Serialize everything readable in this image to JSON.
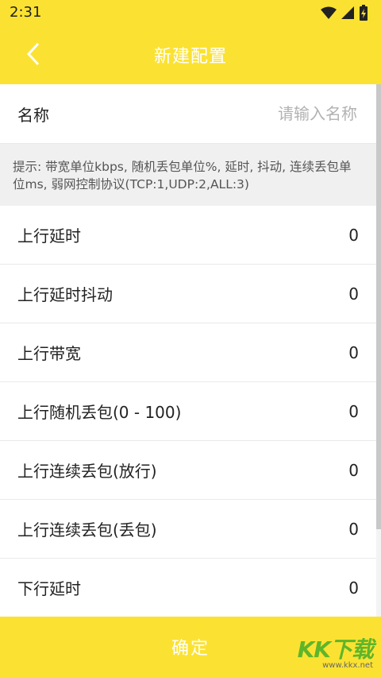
{
  "status": {
    "time": "2:31"
  },
  "header": {
    "title": "新建配置"
  },
  "name_field": {
    "label": "名称",
    "placeholder": "请输入名称",
    "value": ""
  },
  "hint": "提示: 带宽单位kbps, 随机丢包单位%, 延时, 抖动, 连续丢包单位ms, 弱网控制协议(TCP:1,UDP:2,ALL:3)",
  "rows": [
    {
      "label": "上行延时",
      "value": "0"
    },
    {
      "label": "上行延时抖动",
      "value": "0"
    },
    {
      "label": "上行带宽",
      "value": "0"
    },
    {
      "label": "上行随机丢包(0 - 100)",
      "value": "0"
    },
    {
      "label": "上行连续丢包(放行)",
      "value": "0"
    },
    {
      "label": "上行连续丢包(丢包)",
      "value": "0"
    },
    {
      "label": "下行延时",
      "value": "0"
    }
  ],
  "footer": {
    "confirm_label": "确定"
  },
  "watermark": {
    "logo": "KK下载",
    "url": "www.kkx.net"
  },
  "colors": {
    "accent": "#fbe232",
    "hint_bg": "#f0f0f0"
  },
  "icons": {
    "back": "chevron-left-icon",
    "wifi": "wifi-icon",
    "signal": "signal-icon",
    "battery": "battery-icon"
  }
}
